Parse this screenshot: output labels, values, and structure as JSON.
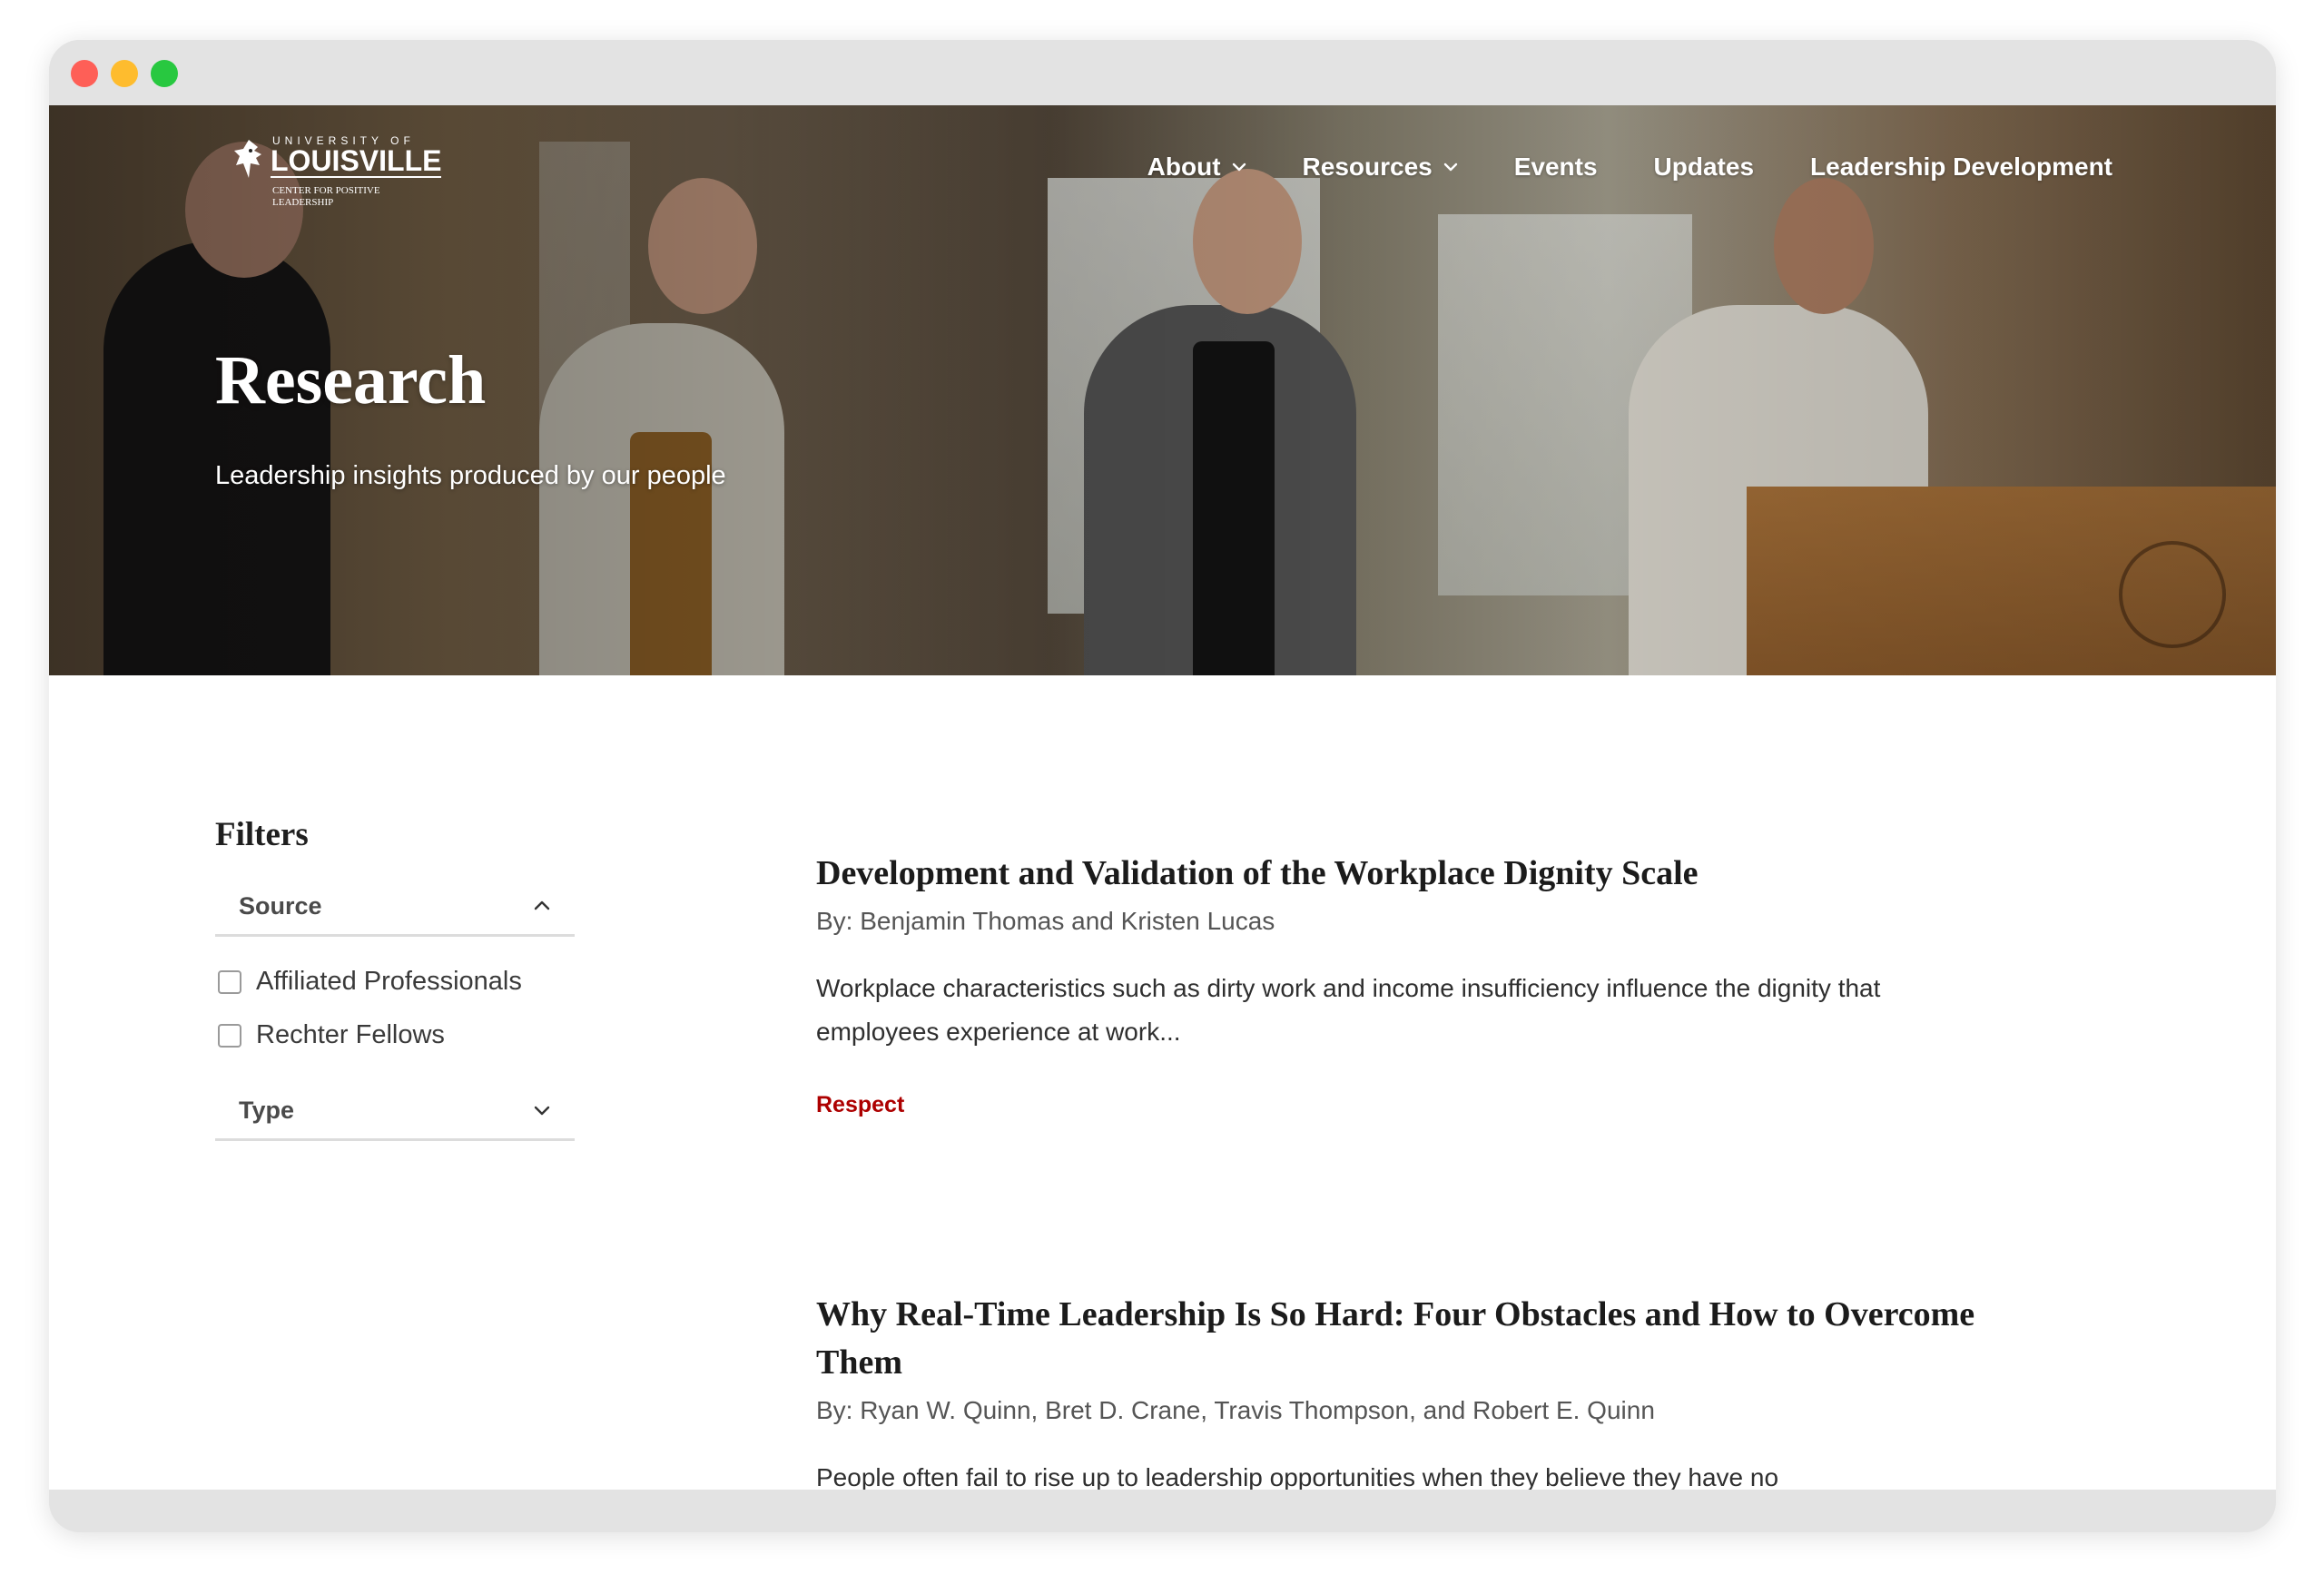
{
  "site": {
    "logo": {
      "top_line": "UNIVERSITY OF",
      "main": "LOUISVILLE",
      "sub_line_1": "CENTER FOR POSITIVE",
      "sub_line_2": "LEADERSHIP"
    },
    "nav": {
      "items": [
        {
          "label": "About",
          "has_dropdown": true,
          "icon": "chevron-down-icon"
        },
        {
          "label": "Resources",
          "has_dropdown": true,
          "icon": "chevron-down-icon"
        },
        {
          "label": "Events",
          "has_dropdown": false
        },
        {
          "label": "Updates",
          "has_dropdown": false
        },
        {
          "label": "Leadership Development",
          "has_dropdown": false
        }
      ]
    }
  },
  "hero": {
    "title": "Research",
    "subtitle": "Leadership insights produced by our people"
  },
  "filters": {
    "heading": "Filters",
    "groups": [
      {
        "label": "Source",
        "expanded": true,
        "icon": "chevron-up-icon",
        "options": [
          {
            "label": "Affiliated Professionals",
            "checked": false
          },
          {
            "label": "Rechter Fellows",
            "checked": false
          }
        ]
      },
      {
        "label": "Type",
        "expanded": false,
        "icon": "chevron-down-icon",
        "options": []
      }
    ]
  },
  "articles": [
    {
      "title": "Development and Validation of the Workplace Dignity Scale",
      "authors": "By: Benjamin Thomas and Kristen Lucas",
      "excerpt": "Workplace characteristics such as dirty work and income insufficiency influence the dignity that employees experience at work...",
      "tag": "Respect"
    },
    {
      "title": "Why Real-Time Leadership Is So Hard: Four Obstacles and How to Overcome Them",
      "authors": "By: Ryan W. Quinn, Bret D. Crane, Travis Thompson, and Robert E. Quinn",
      "excerpt": "People often fail to rise up to leadership opportunities when they believe they have no"
    }
  ],
  "colors": {
    "tag_red": "#ad0000",
    "nav_text": "#ffffff",
    "heading_text": "#1b1b1b",
    "traffic_red": "#fe5f57",
    "traffic_yellow": "#febc2e",
    "traffic_green": "#28c840"
  }
}
